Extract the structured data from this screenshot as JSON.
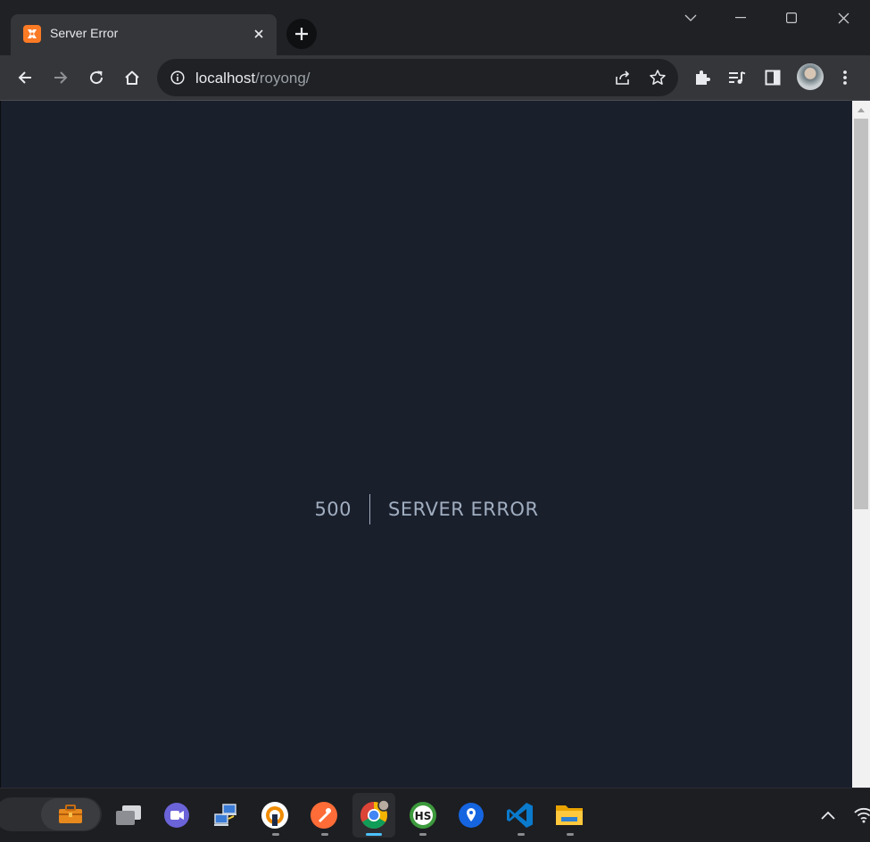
{
  "browser": {
    "tab": {
      "title": "Server Error",
      "favicon": "xampp-icon"
    },
    "url": {
      "host": "localhost",
      "path": "/royong/"
    }
  },
  "page": {
    "error_code": "500",
    "error_message": "SERVER ERROR"
  },
  "taskbar": {
    "apps": [
      "briefcase-app-icon",
      "task-view-icon",
      "chat-app-icon",
      "network-app-icon",
      "vpn-app-icon",
      "postman-icon",
      "chrome-icon",
      "heidisql-icon",
      "maps-icon",
      "vscode-icon",
      "file-explorer-icon"
    ],
    "tray": [
      "show-hidden-icons-icon",
      "wifi-icon"
    ]
  },
  "colors": {
    "page_background": "#1a1f2c",
    "error_text": "#a0aec0",
    "chrome_frame": "#202124",
    "chrome_toolbar": "#35363a",
    "taskbar_active_indicator": "#4cc2ff"
  }
}
